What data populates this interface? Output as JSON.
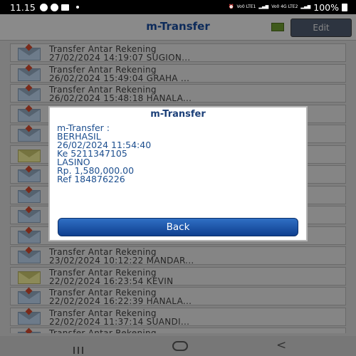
{
  "status_bar": {
    "time": "11.15",
    "icons": [
      "whatsapp-icon",
      "messenger-icon",
      "gallery-icon",
      "dot-icon"
    ],
    "network": [
      "Vo0 LTE1",
      "Vo0 4G LTE2"
    ],
    "battery": "100%"
  },
  "header": {
    "title": "m-Transfer",
    "edit_label": "Edit"
  },
  "transactions": [
    {
      "line1": "Transfer Antar Rekening",
      "line2": "27/02/2024 14:19:07 SUGION...",
      "icon": "envelope-icon"
    },
    {
      "line1": "Transfer Antar Rekening",
      "line2": "26/02/2024 15:49:04 GRAHA ...",
      "icon": "envelope-icon"
    },
    {
      "line1": "Transfer Antar Rekening",
      "line2": "26/02/2024 15:48:18 HANALA...",
      "icon": "envelope-icon"
    },
    {
      "line1": "",
      "line2": "",
      "icon": "envelope-icon"
    },
    {
      "line1": "",
      "line2": "",
      "icon": "envelope-icon"
    },
    {
      "line1": "",
      "line2": "",
      "icon": "envelope-open-icon"
    },
    {
      "line1": "",
      "line2": "",
      "icon": "envelope-icon"
    },
    {
      "line1": "",
      "line2": "",
      "icon": "envelope-icon"
    },
    {
      "line1": "",
      "line2": "",
      "icon": "envelope-icon"
    },
    {
      "line1": "",
      "line2": "",
      "icon": "envelope-icon"
    },
    {
      "line1": "Transfer Antar Rekening",
      "line2": "23/02/2024 10:12:22 MANDAR...",
      "icon": "envelope-icon"
    },
    {
      "line1": "Transfer Antar Rekening",
      "line2": "22/02/2024 16:23:54 KEVIN",
      "icon": "envelope-open-icon"
    },
    {
      "line1": "Transfer Antar Rekening",
      "line2": "22/02/2024 16:22:39 HANALA...",
      "icon": "envelope-icon"
    },
    {
      "line1": "Transfer Antar Rekening",
      "line2": "22/02/2024 11:37:14 SUANDI...",
      "icon": "envelope-icon"
    },
    {
      "line1": "Transfer Antar Rekening",
      "line2": "",
      "icon": "envelope-icon"
    }
  ],
  "dialog": {
    "title": "m-Transfer",
    "lines": [
      "m-Transfer :",
      "BERHASIL",
      "26/02/2024 11:54:40",
      "Ke 5211347105",
      "LASINO",
      "Rp. 1,580,000.00",
      "Ref 184876226"
    ],
    "back_label": "Back"
  }
}
